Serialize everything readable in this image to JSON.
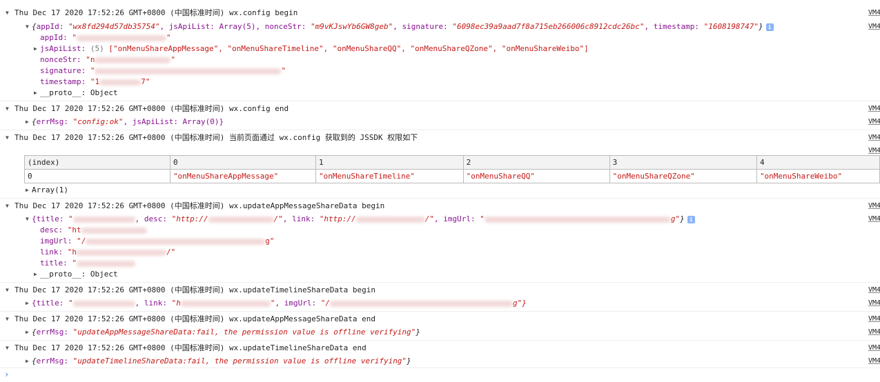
{
  "source_link": "VM4",
  "groups": [
    {
      "header": "Thu Dec 17 2020 17:52:26 GMT+0800 (中国标准时间) wx.config begin"
    },
    {
      "header": "Thu Dec 17 2020 17:52:26 GMT+0800 (中国标准时间) wx.config end"
    },
    {
      "header": "Thu Dec 17 2020 17:52:26 GMT+0800 (中国标准时间) 当前页面通过 wx.config 获取到的 JSSDK 权限如下"
    },
    {
      "header": "Thu Dec 17 2020 17:52:26 GMT+0800 (中国标准时间) wx.updateAppMessageShareData begin"
    },
    {
      "header": "Thu Dec 17 2020 17:52:26 GMT+0800 (中国标准时间) wx.updateTimelineShareData begin"
    },
    {
      "header": "Thu Dec 17 2020 17:52:26 GMT+0800 (中国标准时间) wx.updateAppMessageShareData end"
    },
    {
      "header": "Thu Dec 17 2020 17:52:26 GMT+0800 (中国标准时间) wx.updateTimelineShareData end"
    }
  ],
  "config_obj": {
    "appId_val": "\"wx8fd294d57db35754\"",
    "jsApiList_preview": "jsApiList: Array(5)",
    "nonceStr_val": "\"m9vKJswYb6GW8geb\"",
    "signature_val": "\"6098ec39a9aad7f8a715eb266006c8912cdc26bc\"",
    "timestamp_val": "\"1608198747\"",
    "appId_key": "appId:",
    "appId_short": "\"",
    "jsApiList_key": "jsApiList:",
    "jsApiList_count": "(5)",
    "jsApiList_items": "[\"onMenuShareAppMessage\", \"onMenuShareTimeline\", \"onMenuShareQQ\", \"onMenuShareQZone\", \"onMenuShareWeibo\"]",
    "nonceStr_key": "nonceStr:",
    "nonceStr_short": "\"n",
    "signature_key": "signature:",
    "signature_short": "\"",
    "timestamp_key": "timestamp:",
    "timestamp_short": "\"1",
    "timestamp_end": "7\"",
    "proto": "__proto__: Object"
  },
  "config_end": {
    "errMsg_val": "\"config:ok\"",
    "rest": ", jsApiList: Array(0)}"
  },
  "table": {
    "columns": [
      "(index)",
      "0",
      "1",
      "2",
      "3",
      "4"
    ],
    "rows": [
      [
        "0",
        "\"onMenuShareAppMessage\"",
        "\"onMenuShareTimeline\"",
        "\"onMenuShareQQ\"",
        "\"onMenuShareQZone\"",
        "\"onMenuShareWeibo\""
      ]
    ],
    "array_label": "Array(1)"
  },
  "appmsg_obj": {
    "preview_title_key": "{title: ",
    "preview_desc_key": ", desc: ",
    "preview_desc_val": "\"http://",
    "preview_link_key": ", link: ",
    "preview_link_val": "\"http://",
    "preview_imgUrl_key": ", imgUrl: ",
    "preview_imgUrl_val": "\"",
    "desc_key": "desc:",
    "desc_val": "\"ht",
    "imgUrl_key": "imgUrl:",
    "imgUrl_val": "\"/",
    "imgUrl_end": "g\"",
    "link_key": "link:",
    "link_val": "\"h",
    "link_end": "/\"",
    "title_key": "title:",
    "title_val": "\"",
    "proto": "__proto__: Object"
  },
  "timeline_obj": {
    "preview_title_key": "{title: ",
    "preview_link_key": ", link: ",
    "preview_link_val": "\"h",
    "preview_imgUrl_key": ", imgUrl: ",
    "preview_imgUrl_val": "\"/",
    "preview_end": "g\"}"
  },
  "appmsg_end": {
    "errMsg_val": "\"updateAppMessageShareData:fail, the permission value is offline verifying\""
  },
  "timeline_end": {
    "errMsg_val": "\"updateTimelineShareData:fail, the permission value is offline verifying\""
  },
  "prompt_symbol": "›"
}
